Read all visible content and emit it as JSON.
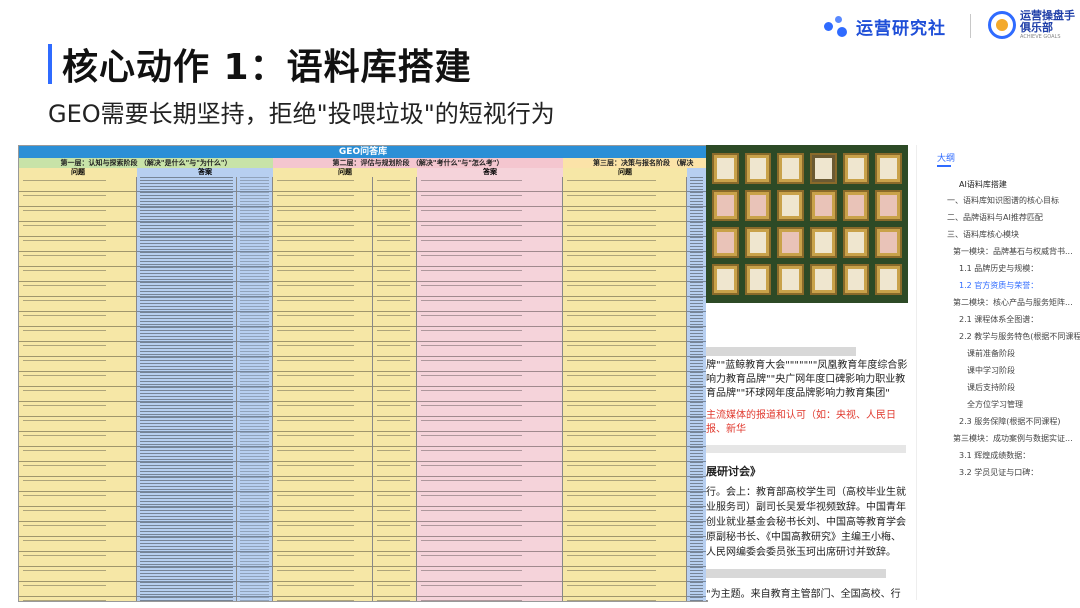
{
  "header": {
    "title": "核心动作 1：语料库搭建",
    "subtitle": "GEO需要长期坚持，拒绝\"投喂垃圾\"的短视行为"
  },
  "brand": {
    "name": "运营研究社",
    "club_line1": "运营操盘手",
    "club_line2": "俱乐部",
    "club_en": "ACHIEVE GOALS"
  },
  "sheet": {
    "title": "GEO问答库",
    "sections": [
      {
        "label": "第一层：认知与探索阶段 （解决\"是什么\"与\"为什么\"）",
        "color": "#c8e3a8"
      },
      {
        "label": "第二层：评估与规划阶段 （解决\"考什么\"与\"怎么考\"）",
        "color": "#f4c6cf"
      },
      {
        "label": "第三层：决策与报名阶段 （解决",
        "color": "#fbe3a8"
      }
    ],
    "col_question": "问题",
    "col_answer": "答案",
    "colors": {
      "yellow": "#f6e7a6",
      "blue": "#b7cff0",
      "pink": "#f5d3da"
    }
  },
  "doc": {
    "quote": "牌\"\"蓝鲸教育大会\"\"\"\"\"\"\"凤凰教育年度综合影响力教育品牌\"\"央广网年度口碑影响力职业教育品牌\"\"环球网年度品牌影响力教育集团\"",
    "media": "主流媒体的报道和认可（如：央视、人民日报、新华",
    "heading": "展研讨会》",
    "body_a": "行。会上：教育部高校学生司（高校毕业生就业服务司）副司长吴爱华视频致辞。中国青年创业就业基金会秘书长刘、中国高等教育学会原副秘书长、《中国高教研究》主编王小梅、人民网编委会委员张玉珂出席研讨并致辞。",
    "body_b": "\"为主题。来自教育主管部门、全国高校、行业学会的专家学"
  },
  "outline": {
    "title": "大纲",
    "items": [
      {
        "label": "AI语料库搭建",
        "level": 0
      },
      {
        "label": "一、语料库知识图谱的核心目标",
        "level": 1
      },
      {
        "label": "二、品牌语料与AI推荐匹配",
        "level": 1
      },
      {
        "label": "三、语料库核心模块",
        "level": 1
      },
      {
        "label": "第一模块：品牌基石与权威背书...",
        "level": 2
      },
      {
        "label": "1.1 品牌历史与规模：",
        "level": 3
      },
      {
        "label": "1.2 官方资质与荣誉：",
        "level": 3,
        "active": true
      },
      {
        "label": "第二模块：核心产品与服务矩阵...",
        "level": 2
      },
      {
        "label": "2.1 课程体系全图谱：",
        "level": 3
      },
      {
        "label": "2.2 教学与服务特色(根据不同课程",
        "level": 3
      },
      {
        "label": "课前准备阶段",
        "level": 4
      },
      {
        "label": "课中学习阶段",
        "level": 4
      },
      {
        "label": "课后支持阶段",
        "level": 4
      },
      {
        "label": "全方位学习管理",
        "level": 4
      },
      {
        "label": "2.3 服务保障(根据不同课程)",
        "level": 3
      },
      {
        "label": "第三模块：成功案例与数据实证...",
        "level": 2
      },
      {
        "label": "3.1 辉煌成绩数据：",
        "level": 3
      },
      {
        "label": "3.2 学员见证与口碑：",
        "level": 3
      }
    ]
  }
}
